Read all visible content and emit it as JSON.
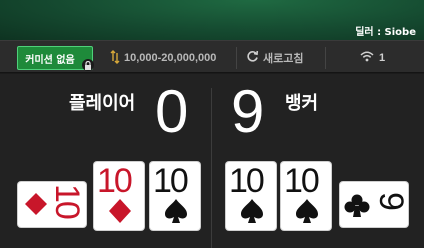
{
  "header": {
    "dealer_label": "딜러 : Siobe"
  },
  "info_bar": {
    "commission_label": "커미션 없음",
    "limits": "10,000-20,000,000",
    "refresh_label": "새로고침",
    "signal_count": "1"
  },
  "player": {
    "label": "플레이어",
    "score": "0",
    "cards": [
      {
        "rank": "10",
        "suit": "diamonds",
        "orientation": "sideways"
      },
      {
        "rank": "10",
        "suit": "diamonds",
        "orientation": "upright"
      },
      {
        "rank": "10",
        "suit": "spades",
        "orientation": "upright"
      }
    ]
  },
  "banker": {
    "label": "뱅커",
    "score": "9",
    "cards": [
      {
        "rank": "10",
        "suit": "spades",
        "orientation": "upright"
      },
      {
        "rank": "10",
        "suit": "spades",
        "orientation": "upright"
      },
      {
        "rank": "9",
        "suit": "clubs",
        "orientation": "sideways"
      }
    ]
  },
  "colors": {
    "felt": "#154a30",
    "commission_btn": "#1e8a3a",
    "red_suit": "#c8162a"
  }
}
